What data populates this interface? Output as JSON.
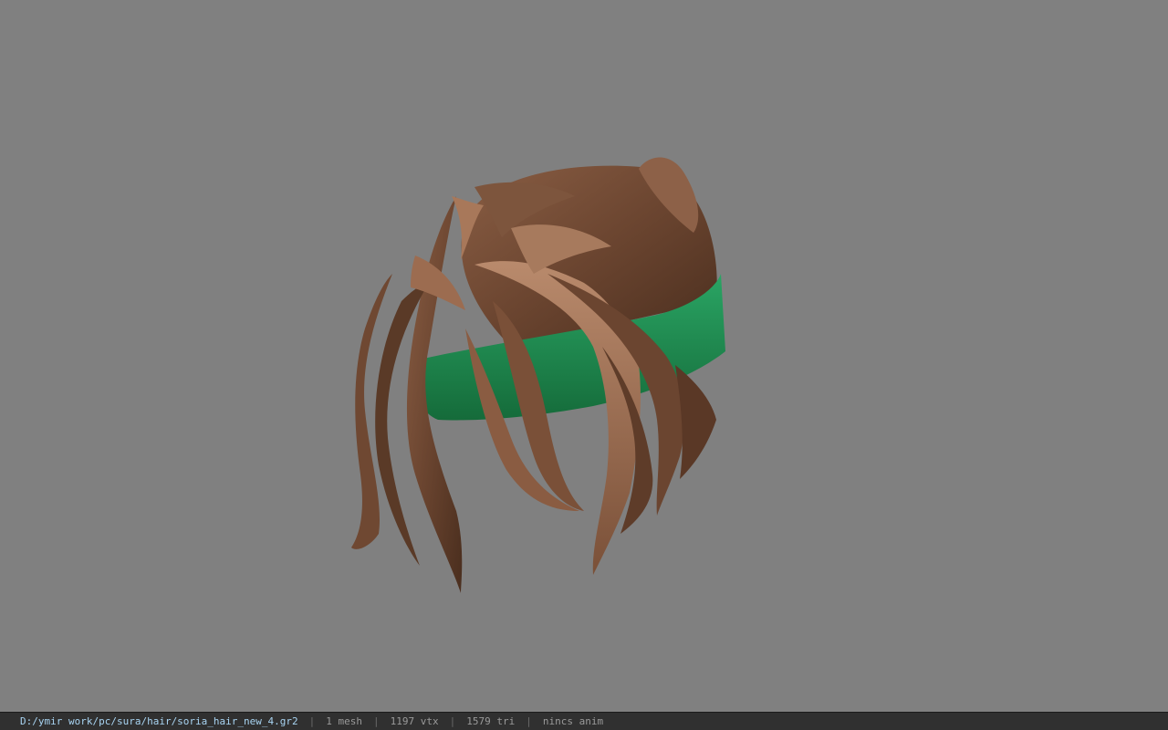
{
  "viewport": {
    "background_color": "#808080",
    "model": {
      "name": "hair-mesh",
      "hair_color": "#6b4530",
      "band_color": "#1f8a4f"
    }
  },
  "status_bar": {
    "file_path": "D:/ymir work/pc/sura/hair/soria_hair_new_4.gr2",
    "separator": "|",
    "mesh_count": "1 mesh",
    "vertex_count": "1197 vtx",
    "triangle_count": "1579 tri",
    "animation": "nincs anim"
  }
}
